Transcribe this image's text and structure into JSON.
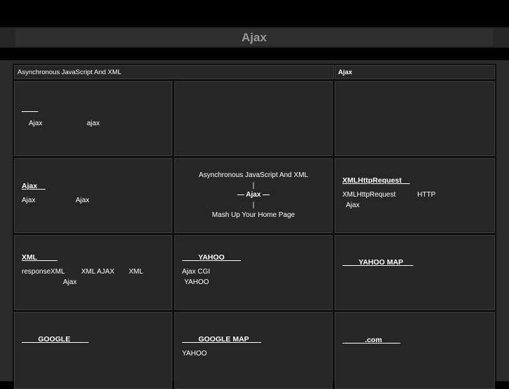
{
  "header": {
    "title": "Ajax"
  },
  "top_row": {
    "left_label": "Asynchronous  JavaScript  And  XML",
    "right_label": "Ajax"
  },
  "cells": {
    "r1c1": {
      "title": "____",
      "line1_a": "Ajax",
      "line1_b": "ajax"
    },
    "r2c1": {
      "title": "Ajax    ",
      "line1_a": "Ajax",
      "line1_b": "Ajax"
    },
    "r2c2": {
      "line1": "Asynchronous JavaScript And XML",
      "sep1": "|",
      "line2": "— Ajax —",
      "sep2": "|",
      "line3": "Mash Up Your Home Page"
    },
    "r2c3": {
      "title": "XMLHttpRequest    ",
      "line1_a": "XMLHttpRequest",
      "line1_b": "HTTP",
      "line2": "Ajax"
    },
    "r3c1": {
      "title": "XML          ",
      "line1_a": "responseXML",
      "line1_b": "XML AJAX",
      "line1_c": "XML",
      "line2": "Ajax"
    },
    "r3c2": {
      "title": "        YAHOO        ",
      "line1": "Ajax CGI",
      "line2": "YAHOO"
    },
    "r3c3": {
      "title": "        YAHOO MAP     "
    },
    "r4c1": {
      "title": "        GOOGLE         "
    },
    "r4c2": {
      "title": "        GOOGLE MAP      ",
      "line1": "YAHOO"
    },
    "r4c3": {
      "title": "           .com         "
    }
  }
}
